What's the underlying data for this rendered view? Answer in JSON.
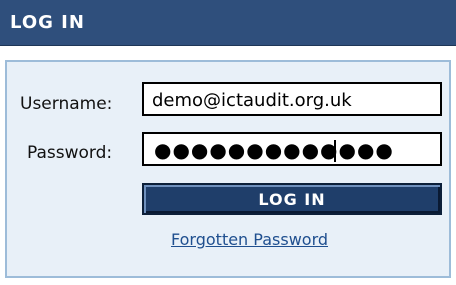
{
  "header": {
    "title": "LOG IN"
  },
  "form": {
    "username_label": "Username:",
    "username_value": "demo@ictaudit.org.uk",
    "password_label": "Password:",
    "password_mask": "●●●●●●●●●●●●●",
    "login_button_label": "LOG IN",
    "forgot_link_label": "Forgotten Password"
  },
  "colors": {
    "header_bg": "#2f4f7c",
    "panel_bg": "#e8f0f8",
    "panel_border": "#9dbcd9",
    "button_bg": "#1f3e6a",
    "link": "#1f4f8f"
  }
}
